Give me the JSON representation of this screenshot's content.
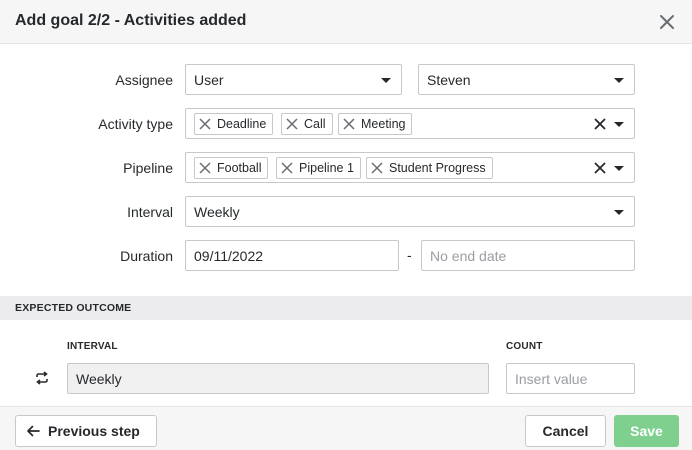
{
  "header": {
    "title": "Add goal 2/2 - Activities added",
    "close_icon": "close-icon"
  },
  "form": {
    "assignee": {
      "label": "Assignee",
      "type_value": "User",
      "user_value": "Steven"
    },
    "activity_type": {
      "label": "Activity type",
      "chips": [
        "Deadline",
        "Call",
        "Meeting"
      ]
    },
    "pipeline": {
      "label": "Pipeline",
      "chips": [
        "Football",
        "Pipeline 1",
        "Student Progress"
      ]
    },
    "interval": {
      "label": "Interval",
      "value": "Weekly"
    },
    "duration": {
      "label": "Duration",
      "start_value": "09/11/2022",
      "separator": "-",
      "end_placeholder": "No end date"
    }
  },
  "expected_outcome": {
    "section_title": "EXPECTED OUTCOME",
    "interval_label": "INTERVAL",
    "interval_value": "Weekly",
    "count_label": "COUNT",
    "count_placeholder": "Insert value",
    "repeat_icon": "repeat-icon"
  },
  "footer": {
    "previous_label": "Previous step",
    "cancel_label": "Cancel",
    "save_label": "Save"
  },
  "colors": {
    "save_button": "#7fcf8f",
    "header_bg": "#f6f6f7",
    "section_bg": "#ececee"
  }
}
